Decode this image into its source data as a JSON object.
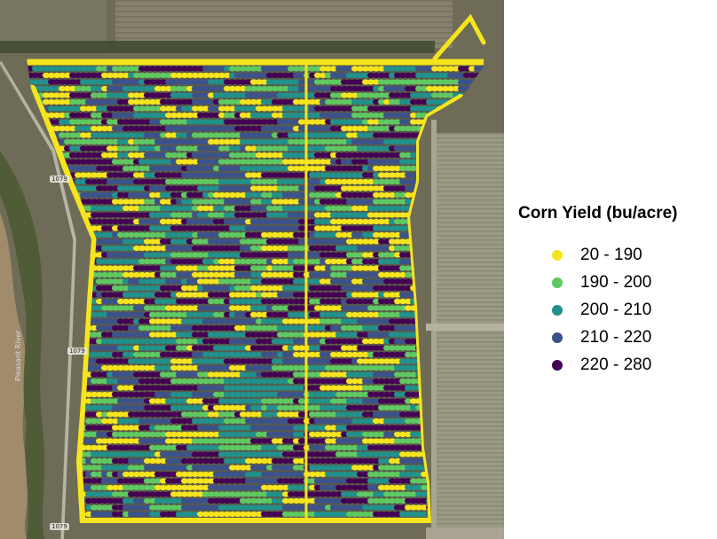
{
  "map": {
    "road_labels": [
      "1079",
      "1079",
      "1079"
    ],
    "river_label": "Pleasant River"
  },
  "legend": {
    "title": "Corn Yield (bu/acre)",
    "items": [
      {
        "label": "20 - 190",
        "color": "#f5e41e",
        "icon": "dot-yellow-icon"
      },
      {
        "label": "190 - 200",
        "color": "#5ec962",
        "icon": "dot-green-icon"
      },
      {
        "label": "200 - 210",
        "color": "#21918c",
        "icon": "dot-teal-icon"
      },
      {
        "label": "210 - 220",
        "color": "#3b528b",
        "icon": "dot-blue-icon"
      },
      {
        "label": "220 - 280",
        "color": "#440154",
        "icon": "dot-purple-icon"
      }
    ]
  }
}
